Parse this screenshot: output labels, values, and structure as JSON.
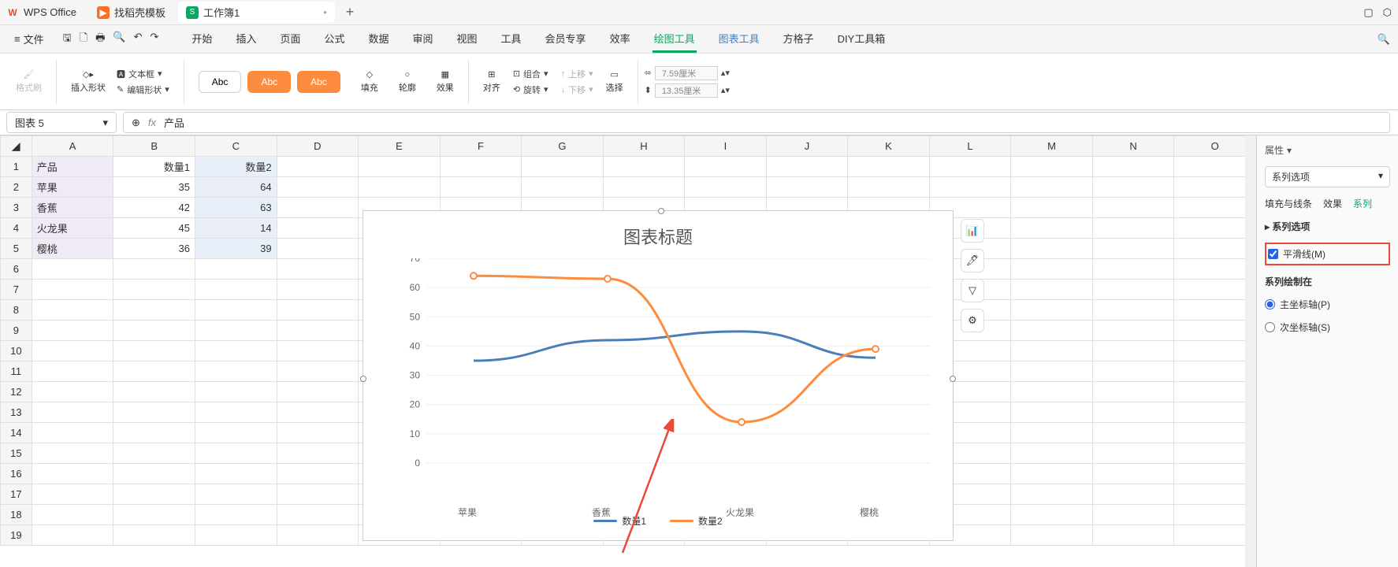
{
  "titlebar": {
    "app_name": "WPS Office",
    "tab_template": "找稻壳模板",
    "tab_workbook": "工作簿1",
    "plus": "+"
  },
  "menubar": {
    "menu_icon": "≡",
    "file": "文件",
    "tabs": {
      "start": "开始",
      "insert": "插入",
      "page": "页面",
      "formula": "公式",
      "data": "数据",
      "review": "审阅",
      "view": "视图",
      "tools": "工具",
      "member": "会员专享",
      "efficiency": "效率",
      "draw_tools": "绘图工具",
      "chart_tools": "图表工具",
      "fanggezi": "方格子",
      "diy": "DIY工具箱"
    }
  },
  "ribbon": {
    "format_painter": "格式刷",
    "insert_shape": "插入形状",
    "text_box": "文本框",
    "edit_shape": "编辑形状",
    "abc": "Abc",
    "fill": "填充",
    "outline": "轮廓",
    "effect": "效果",
    "align": "对齐",
    "group": "组合",
    "rotate": "旋转",
    "move_up": "上移",
    "move_down": "下移",
    "select": "选择",
    "width_val": "7.59厘米",
    "height_val": "13.35厘米"
  },
  "formula_bar": {
    "name": "图表 5",
    "fx": "fx",
    "content": "产品"
  },
  "sheet": {
    "cols": [
      "A",
      "B",
      "C",
      "D",
      "E",
      "F",
      "G",
      "H",
      "I",
      "J",
      "K",
      "L",
      "M",
      "N",
      "O"
    ],
    "rows": [
      "1",
      "2",
      "3",
      "4",
      "5",
      "6",
      "7",
      "8",
      "9",
      "10",
      "11",
      "12",
      "13",
      "14",
      "15",
      "16",
      "17",
      "18",
      "19"
    ],
    "data": {
      "A1": "产品",
      "B1": "数量1",
      "C1": "数量2",
      "A2": "苹果",
      "B2": "35",
      "C2": "64",
      "A3": "香蕉",
      "B3": "42",
      "C3": "63",
      "A4": "火龙果",
      "B4": "45",
      "C4": "14",
      "A5": "樱桃",
      "B5": "36",
      "C5": "39"
    }
  },
  "chart_data": {
    "type": "line",
    "title": "图表标题",
    "categories": [
      "苹果",
      "香蕉",
      "火龙果",
      "樱桃"
    ],
    "series": [
      {
        "name": "数量1",
        "values": [
          35,
          42,
          45,
          36
        ],
        "color": "#4a7ebb"
      },
      {
        "name": "数量2",
        "values": [
          64,
          63,
          14,
          39
        ],
        "color": "#fd8c3e"
      }
    ],
    "ylim": [
      0,
      70
    ],
    "yticks": [
      0,
      10,
      20,
      30,
      40,
      50,
      60,
      70
    ]
  },
  "side_panel": {
    "attr": "属性",
    "dropdown": "系列选项",
    "tab_fill": "填充与线条",
    "tab_effect": "效果",
    "tab_series": "系列",
    "section_options": "系列选项",
    "smooth_line": "平滑线(M)",
    "plot_on": "系列绘制在",
    "primary_axis": "主坐标轴(P)",
    "secondary_axis": "次坐标轴(S)"
  }
}
